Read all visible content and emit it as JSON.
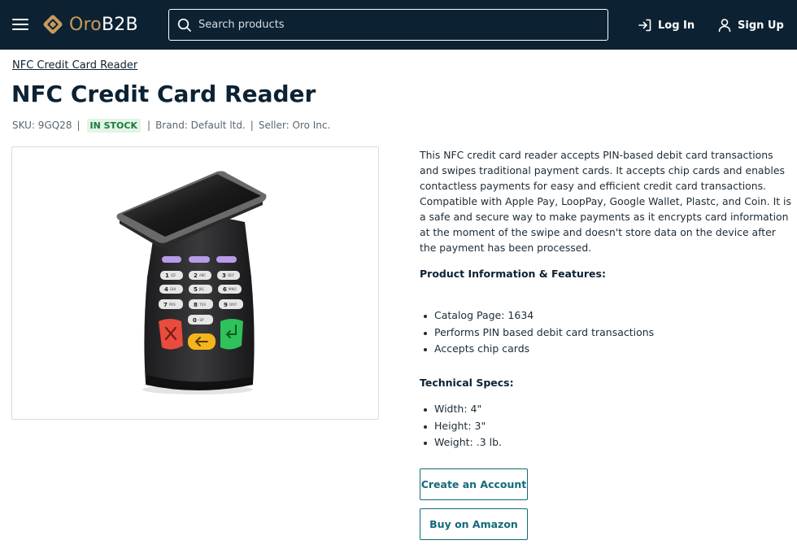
{
  "header": {
    "menu_icon": "hamburger-menu-icon",
    "logo": {
      "part1": "Oro",
      "part2": "B2B"
    },
    "search": {
      "placeholder": "Search products",
      "value": "",
      "icon": "search-icon"
    },
    "login_label": "Log In",
    "login_icon": "login-icon",
    "signup_label": "Sign Up",
    "signup_icon": "user-icon",
    "background_color": "#0c2233",
    "brand_color": "#c99a5b"
  },
  "breadcrumb": {
    "label": "NFC Credit Card Reader"
  },
  "product": {
    "title": "NFC Credit Card Reader",
    "sku": "SKU: 9GQ28",
    "stock_status": "IN STOCK",
    "brand": "Brand: Default ltd.",
    "seller": "Seller: Oro Inc.",
    "description": "This NFC credit card reader accepts PIN-based debit card transactions and swipes traditional payment cards. It accepts chip cards and enables contactless payments for easy and efficient credit card transactions. Compatible with Apple Pay, LoopPay, Google Wallet, Plastc, and Coin. It is a safe and secure way to make payments as it encrypts card information at the moment of the swipe and doesn't store data on the device after the payment has been processed.",
    "features_title": "Product Information & Features:",
    "features": [
      "Catalog Page: 1634",
      "Performs PIN based debit card transactions",
      "Accepts chip cards"
    ],
    "specs_title": "Technical Specs:",
    "specs": [
      "Width: 4\"",
      "Height: 3\"",
      "Weight: .3 lb."
    ],
    "keypad_keys": [
      "1",
      "2",
      "3",
      "4",
      "5",
      "6",
      "7",
      "8",
      "9",
      "0"
    ],
    "keypad_sublabels": [
      "QZ",
      "ABC",
      "DEF",
      "GHI",
      "JKL",
      "MNO",
      "PRS",
      "TUV",
      "WXY",
      "-SP"
    ]
  },
  "actions": {
    "create_account_label": "Create an Account",
    "buy_amazon_label": "Buy on Amazon",
    "accent_color": "#146a7a"
  }
}
